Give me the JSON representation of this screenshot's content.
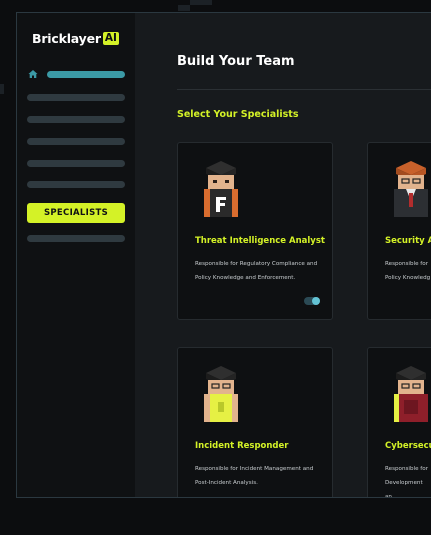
{
  "app": {
    "logo_text": "Bricklayer",
    "logo_badge": "AI"
  },
  "sidebar": {
    "active_item": "SPECIALISTS",
    "icons": {
      "home": "home-icon"
    }
  },
  "header": {
    "title": "Build Your Team"
  },
  "section": {
    "title": "Select Your Specialists"
  },
  "cards": [
    {
      "title": "Threat Intelligence Analyst",
      "description": "Responsible for Regulatory Compliance and Policy Knowledge and Enforcement.",
      "enabled": true
    },
    {
      "title": "Security A",
      "description": "Responsible for Policy Knowledg",
      "enabled": true
    },
    {
      "title": "Incident Responder",
      "description": "Responsible for Incident Management and Post-Incident Analysis.",
      "enabled": true
    },
    {
      "title": "Cybersecu",
      "description": "Responsible for Development an",
      "enabled": true
    }
  ],
  "colors": {
    "accent": "#d4f227",
    "teal": "#3b9aa6",
    "background": "#171a1d",
    "sidebar": "#0f1113",
    "card": "#0e1012"
  }
}
